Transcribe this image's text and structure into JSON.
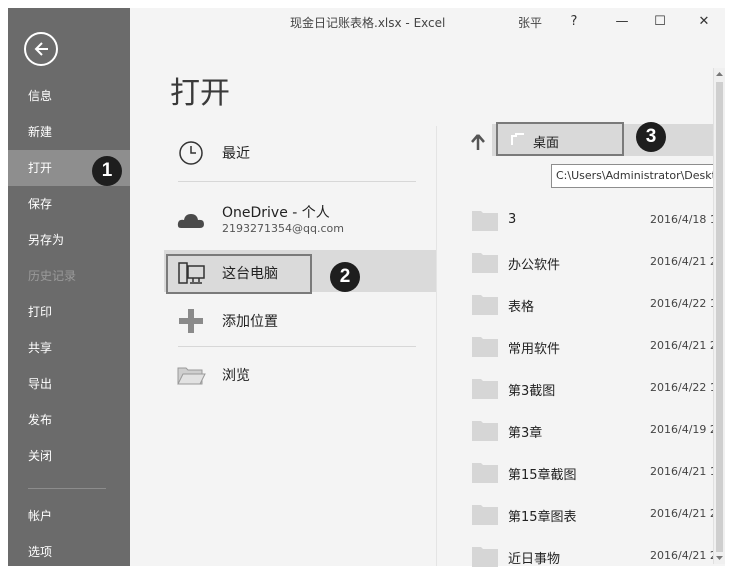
{
  "window": {
    "title": "现金日记账表格.xlsx - Excel",
    "user": "张平",
    "help": "?",
    "minimize": "—",
    "maximize": "☐",
    "close": "✕"
  },
  "sidebar": {
    "items": [
      {
        "label": "信息"
      },
      {
        "label": "新建"
      },
      {
        "label": "打开"
      },
      {
        "label": "保存"
      },
      {
        "label": "另存为"
      },
      {
        "label": "历史记录"
      },
      {
        "label": "打印"
      },
      {
        "label": "共享"
      },
      {
        "label": "导出"
      },
      {
        "label": "发布"
      },
      {
        "label": "关闭"
      },
      {
        "label": "帐户"
      },
      {
        "label": "选项"
      }
    ]
  },
  "main": {
    "title": "打开",
    "places": [
      {
        "label": "最近",
        "icon": "clock-icon"
      },
      {
        "label": "OneDrive - 个人",
        "sublabel": "2193271354@qq.com",
        "icon": "cloud-icon"
      },
      {
        "label": "这台电脑",
        "icon": "computer-icon"
      },
      {
        "label": "添加位置",
        "icon": "plus-icon"
      },
      {
        "label": "浏览",
        "icon": "folder-open-icon"
      }
    ],
    "location": {
      "label": "桌面",
      "tooltip": "C:\\Users\\Administrator\\Desktop"
    },
    "folders": [
      {
        "name": "3",
        "date": "2016/4/18 1"
      },
      {
        "name": "办公软件",
        "date": "2016/4/21 2"
      },
      {
        "name": "表格",
        "date": "2016/4/22 1"
      },
      {
        "name": "常用软件",
        "date": "2016/4/21 2"
      },
      {
        "name": "第3截图",
        "date": "2016/4/22 1"
      },
      {
        "name": "第3章",
        "date": "2016/4/19 2"
      },
      {
        "name": "第15章截图",
        "date": "2016/4/21 1"
      },
      {
        "name": "第15章图表",
        "date": "2016/4/21 2"
      },
      {
        "name": "近日事物",
        "date": "2016/4/21 2"
      }
    ]
  },
  "callouts": [
    "1",
    "2",
    "3"
  ],
  "colors": {
    "sidebar_bg": "#6b6b6b",
    "sidebar_selected": "#8e8e8e",
    "content_bg": "#f4f4f4",
    "highlight_bg": "#dadada",
    "badge_bg": "#1e1e1e"
  }
}
